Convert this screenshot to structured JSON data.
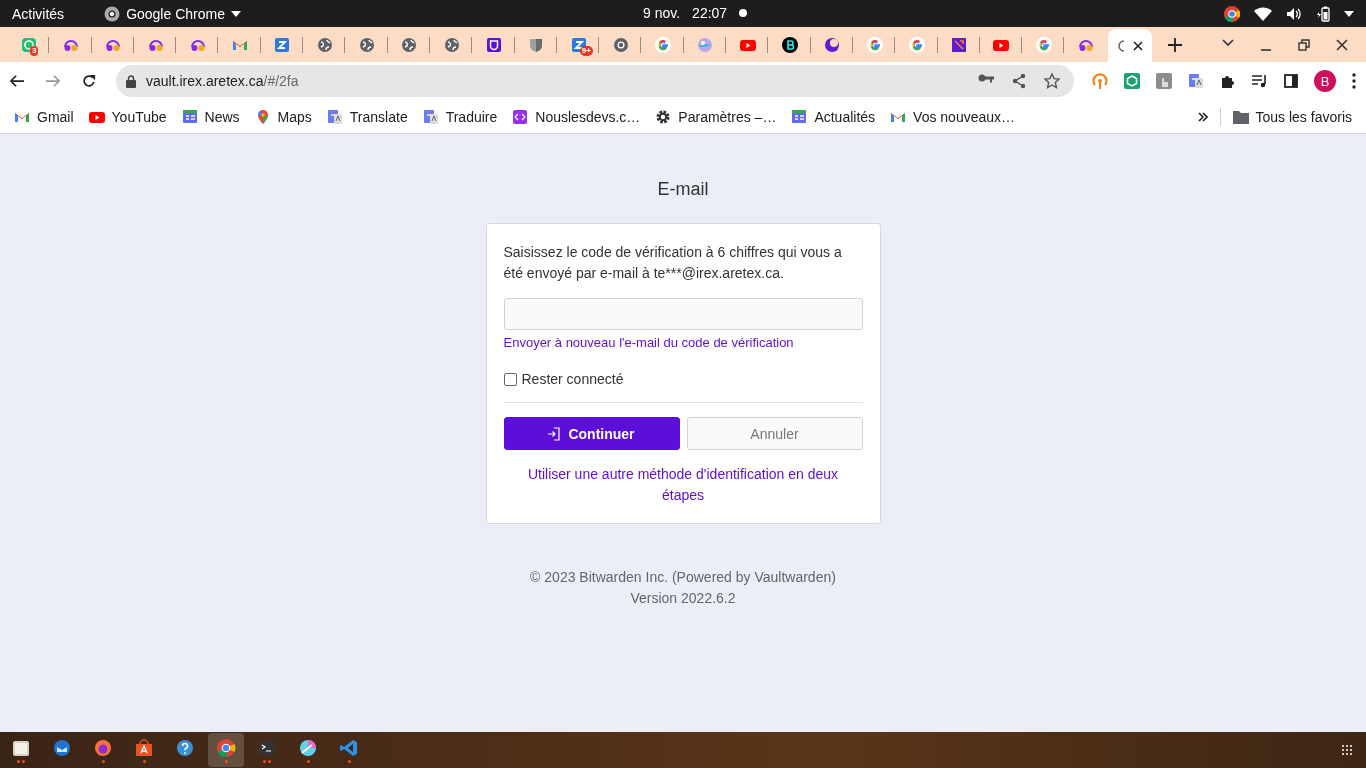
{
  "top_bar": {
    "activities": "Activités",
    "app_name": "Google Chrome",
    "date": "9 nov.",
    "time": "22:07"
  },
  "tabs": [
    {
      "kind": "chat",
      "badge": "3",
      "selected": false
    },
    {
      "kind": "headphones",
      "selected": false
    },
    {
      "kind": "headphones",
      "selected": false
    },
    {
      "kind": "headphones",
      "selected": false
    },
    {
      "kind": "headphones",
      "selected": false
    },
    {
      "kind": "gmail",
      "selected": false
    },
    {
      "kind": "zoho",
      "selected": false
    },
    {
      "kind": "globe",
      "selected": false
    },
    {
      "kind": "globe",
      "selected": false
    },
    {
      "kind": "globe",
      "selected": false
    },
    {
      "kind": "globe",
      "selected": false
    },
    {
      "kind": "shield-u",
      "selected": false
    },
    {
      "kind": "shield",
      "selected": false
    },
    {
      "kind": "zoho",
      "badge": "9+",
      "selected": false
    },
    {
      "kind": "chrome",
      "selected": false
    },
    {
      "kind": "google",
      "selected": false
    },
    {
      "kind": "sphere",
      "selected": false
    },
    {
      "kind": "youtube",
      "selected": false
    },
    {
      "kind": "b-circle",
      "selected": false
    },
    {
      "kind": "moon",
      "selected": false
    },
    {
      "kind": "google",
      "selected": false
    },
    {
      "kind": "google",
      "selected": false
    },
    {
      "kind": "square",
      "selected": false
    },
    {
      "kind": "youtube",
      "selected": false
    },
    {
      "kind": "google",
      "selected": false
    },
    {
      "kind": "headphones",
      "selected": false
    },
    {
      "kind": "blank",
      "selected": true
    }
  ],
  "address_bar": {
    "host": "vault.irex.aretex.ca",
    "path": "/#/2fa"
  },
  "profile": {
    "initial": "B"
  },
  "bookmarks": [
    {
      "kind": "gmail",
      "label": "Gmail"
    },
    {
      "kind": "youtube",
      "label": "YouTube"
    },
    {
      "kind": "news",
      "label": "News"
    },
    {
      "kind": "maps",
      "label": "Maps"
    },
    {
      "kind": "translate",
      "label": "Translate"
    },
    {
      "kind": "translate",
      "label": "Traduire"
    },
    {
      "kind": "code",
      "label": "Nouslesdevs.c…"
    },
    {
      "kind": "gear",
      "label": "Paramètres –…"
    },
    {
      "kind": "news",
      "label": "Actualités"
    },
    {
      "kind": "gmail",
      "label": "Vos nouveaux…"
    }
  ],
  "all_bookmarks": {
    "label": "Tous les favoris"
  },
  "login": {
    "heading": "E-mail",
    "instructions": "Saisissez le code de vérification à 6 chiffres qui vous a été envoyé par e-mail à te***@irex.aretex.ca.",
    "resend_link": "Envoyer à nouveau l'e-mail du code de vérification",
    "remember": {
      "label": "Rester connecté",
      "checked": false
    },
    "continue_button": "Continuer",
    "cancel_button": "Annuler",
    "other_method_link": "Utiliser une autre méthode d'identification en deux étapes"
  },
  "footer": {
    "copyright": "© 2023 Bitwarden Inc. (Powered by Vaultwarden)",
    "version": "Version 2022.6.2"
  },
  "dock": [
    {
      "kind": "files",
      "running": true,
      "multiple": true,
      "selected": false
    },
    {
      "kind": "thunderbird",
      "running": false,
      "selected": false
    },
    {
      "kind": "firefox",
      "running": true,
      "multiple": false,
      "selected": false
    },
    {
      "kind": "software",
      "running": true,
      "multiple": false,
      "selected": false
    },
    {
      "kind": "help",
      "running": false,
      "selected": false
    },
    {
      "kind": "chrome",
      "running": true,
      "multiple": false,
      "selected": true
    },
    {
      "kind": "terminal",
      "running": true,
      "multiple": true,
      "selected": false
    },
    {
      "kind": "paint",
      "running": true,
      "multiple": false,
      "selected": false
    },
    {
      "kind": "vscode",
      "running": true,
      "multiple": false,
      "selected": false
    }
  ]
}
